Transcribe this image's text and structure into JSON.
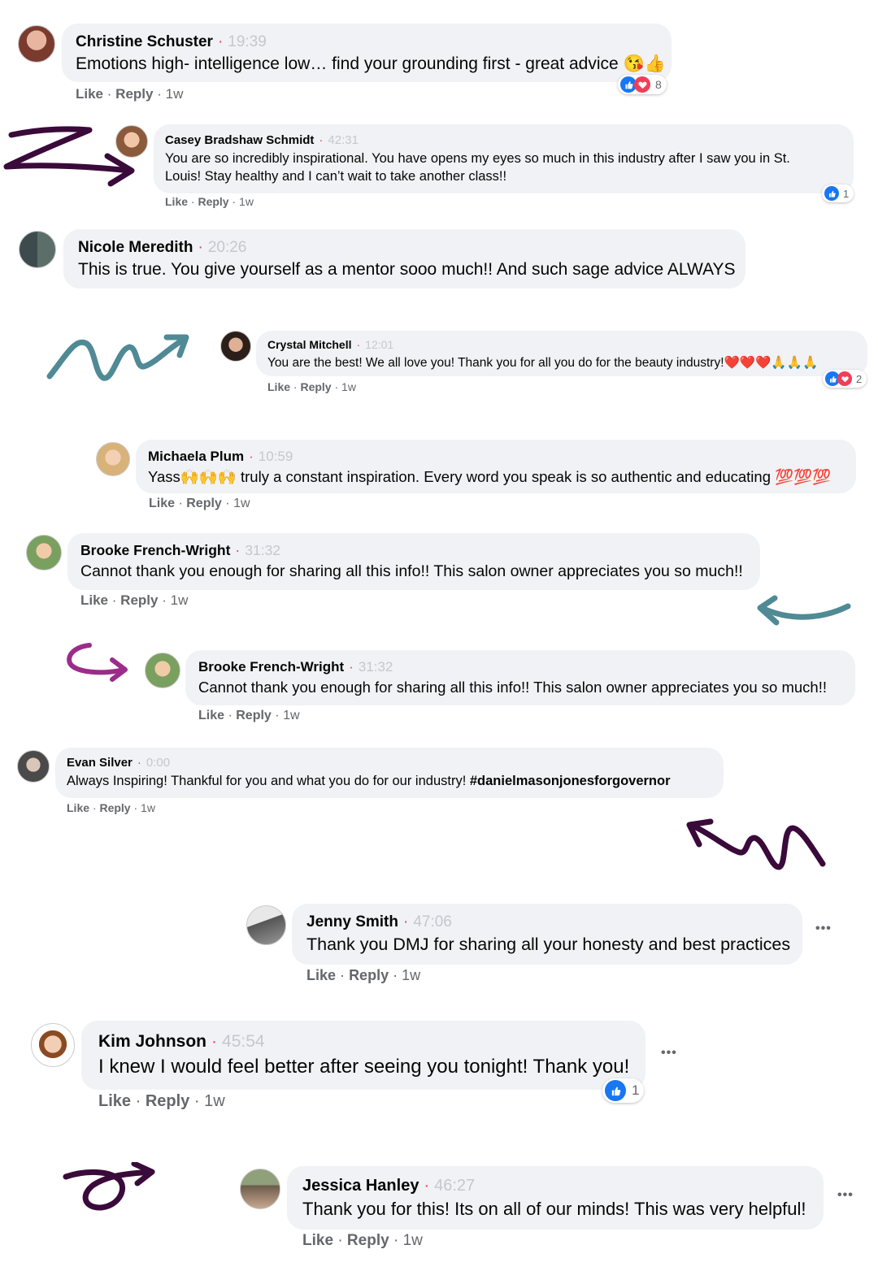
{
  "labels": {
    "like": "Like",
    "reply": "Reply",
    "sep": "·"
  },
  "comments": [
    {
      "name": "Christine Schuster",
      "time": "19:39",
      "text": "Emotions high- intelligence low… find your grounding first - great advice 😘👍",
      "age": "1w",
      "reactions": "8"
    },
    {
      "name": "Casey Bradshaw Schmidt",
      "time": "42:31",
      "text": "You are so incredibly inspirational. You have opens my eyes so much in this industry after I saw you in St.",
      "text2": "Louis! Stay healthy and I can’t wait to take another class!!",
      "age": "1w",
      "reactions": "1"
    },
    {
      "name": "Nicole Meredith",
      "time": "20:26",
      "text": "This is true. You give yourself as a mentor sooo much!! And such sage advice ALWAYS"
    },
    {
      "name": "Crystal Mitchell",
      "time": "12:01",
      "text": "You are the best! We all love you! Thank you for all you do for the beauty industry!❤️❤️❤️🙏🙏🙏",
      "age": "1w",
      "reactions": "2"
    },
    {
      "name": "Michaela Plum",
      "time": "10:59",
      "text": "Yass🙌🙌🙌 truly a constant inspiration. Every word you speak is so authentic and educating 💯💯💯",
      "age": "1w"
    },
    {
      "name": "Brooke French-Wright",
      "time": "31:32",
      "text": "Cannot thank you enough for sharing all this info!! This salon owner appreciates you so much!!",
      "age": "1w"
    },
    {
      "name": "Brooke French-Wright",
      "time": "31:32",
      "text": "Cannot thank you enough for sharing all this info!! This salon owner appreciates you so much!!",
      "age": "1w"
    },
    {
      "name": "Evan Silver",
      "time": "0:00",
      "text": "Always Inspiring! Thankful for you and what you do for our industry! ",
      "hashtag": "#danielmasonjonesforgovernor",
      "age": "1w"
    },
    {
      "name": "Jenny Smith",
      "time": "47:06",
      "text": "Thank you DMJ for sharing all your honesty and best practices",
      "age": "1w",
      "more": "•••"
    },
    {
      "name": "Kim Johnson",
      "time": "45:54",
      "text": "I knew I would feel better after seeing you tonight! Thank you!",
      "age": "1w",
      "reactions": "1",
      "more": "•••"
    },
    {
      "name": "Jessica Hanley",
      "time": "46:27",
      "text": "Thank you for this! Its on all of our minds! This was very helpful!",
      "age": "1w",
      "more": "•••"
    }
  ],
  "colors": {
    "bubble": "#f0f2f5",
    "like_blue": "#1877f2",
    "love_red": "#f33e58",
    "arrow_dark": "#3a0a3a",
    "arrow_teal": "#4f8a95",
    "arrow_magenta": "#9b2c8a"
  }
}
